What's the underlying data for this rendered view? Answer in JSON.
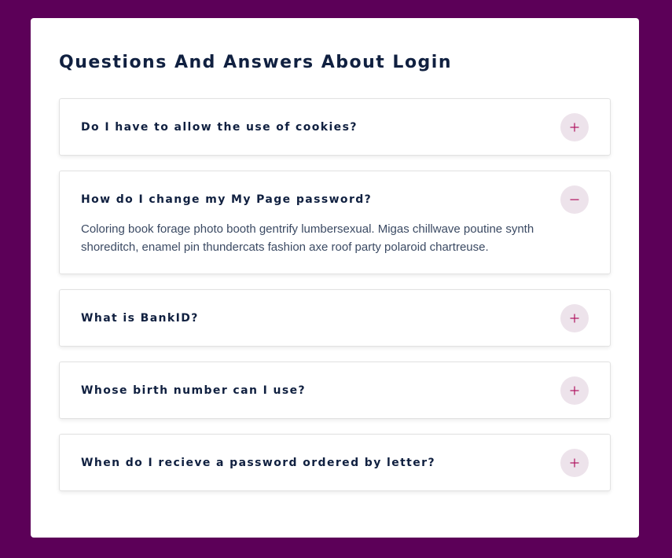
{
  "page": {
    "title": "Questions And Answers About Login"
  },
  "faq": [
    {
      "question": "Do I have to allow the use of cookies?",
      "expanded": false,
      "icon": "plus-icon"
    },
    {
      "question": "How do I change my My Page password?",
      "expanded": true,
      "icon": "minus-icon",
      "answer": "Coloring book forage photo booth gentrify lumbersexual. Migas chillwave poutine synth shoreditch, enamel pin thundercats fashion axe roof party polaroid chartreuse."
    },
    {
      "question": "What is BankID?",
      "expanded": false,
      "icon": "plus-icon"
    },
    {
      "question": "Whose birth number can I use?",
      "expanded": false,
      "icon": "plus-icon"
    },
    {
      "question": "When do I recieve a password ordered by letter?",
      "expanded": false,
      "icon": "plus-icon"
    }
  ],
  "colors": {
    "background": "#5c0058",
    "card": "#ffffff",
    "heading": "#102040",
    "accent": "#b0125f",
    "toggle_bg": "#ede3eb"
  }
}
